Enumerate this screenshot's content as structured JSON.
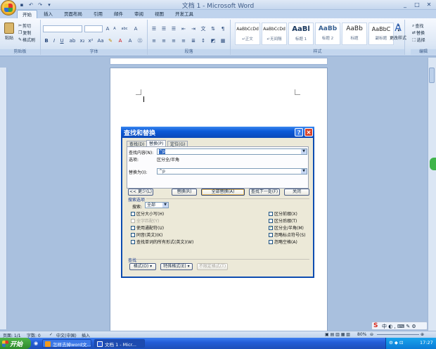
{
  "window": {
    "title": "文档 1 - Microsoft Word",
    "min": "_",
    "max": "□",
    "close": "✕"
  },
  "tabs": [
    "开始",
    "插入",
    "页面布局",
    "引用",
    "邮件",
    "审阅",
    "视图",
    "开发工具"
  ],
  "ribbon": {
    "clipboard": {
      "label": "剪贴板",
      "paste": "粘贴",
      "cut": "剪切",
      "copy": "复制",
      "format_painter": "格式刷"
    },
    "font": {
      "label": "字体",
      "bold": "B",
      "italic": "I",
      "underline": "U",
      "grow": "A",
      "shrink": "A",
      "clear": "abc",
      "char_border": "A"
    },
    "paragraph": {
      "label": "段落"
    },
    "styles": {
      "label": "样式",
      "items": [
        {
          "sample": "AaBbCcDd",
          "name": "↵正文"
        },
        {
          "sample": "AaBbCcDd",
          "name": "↵无间隔"
        },
        {
          "sample": "AaBl",
          "name": "标题 1"
        },
        {
          "sample": "AaBb",
          "name": "标题 2"
        },
        {
          "sample": "AaBb",
          "name": "标题"
        },
        {
          "sample": "AaBbC",
          "name": "副标题"
        }
      ],
      "change_styles": "更改样式"
    },
    "editing": {
      "label": "编辑",
      "find": "查找",
      "replace": "替换",
      "select": "选择"
    }
  },
  "dialog": {
    "title": "查找和替换",
    "help": "?",
    "close": "✕",
    "tabs": [
      "查找(D)",
      "替换(P)",
      "定位(G)"
    ],
    "find_label": "查找内容(N):",
    "find_value": "^p",
    "options_label": "选项:",
    "options_value": "区分全/半角",
    "replace_label": "替换为(I):",
    "replace_value": "^p",
    "buttons": {
      "less": "<< 更少(L)",
      "replace": "替换(R)",
      "replace_all": "全部替换(A)",
      "find_next": "查找下一处(F)",
      "close": "关闭"
    },
    "search_options_title": "搜索选项",
    "search_label": "搜索:",
    "search_value": "全部",
    "left_options": [
      {
        "label": "区分大小写(H)",
        "checked": false,
        "disabled": false
      },
      {
        "label": "全字匹配(Y)",
        "checked": false,
        "disabled": true
      },
      {
        "label": "使用通配符(U)",
        "checked": false,
        "disabled": false
      },
      {
        "label": "同音(英文)(K)",
        "checked": false,
        "disabled": false
      },
      {
        "label": "查找单词的所有形式(英文)(W)",
        "checked": false,
        "disabled": false
      }
    ],
    "right_options": [
      {
        "label": "区分前缀(X)",
        "checked": false,
        "disabled": false
      },
      {
        "label": "区分后缀(T)",
        "checked": false,
        "disabled": false
      },
      {
        "label": "区分全/半角(M)",
        "checked": true,
        "disabled": false
      },
      {
        "label": "忽略标点符号(S)",
        "checked": false,
        "disabled": false
      },
      {
        "label": "忽略空格(A)",
        "checked": false,
        "disabled": false
      }
    ],
    "find_section_title": "查找",
    "bottom_buttons": {
      "format": "格式(O) ▾",
      "special": "特殊格式(E) ▾",
      "no_format": "不限定格式(T)"
    }
  },
  "status": {
    "page": "页面: 1/1",
    "words": "字数: 0",
    "language": "中文(中国)",
    "mode": "插入",
    "zoom": "80%"
  },
  "taskbar": {
    "start": "开始",
    "tasks": [
      "怎样去掉word文...",
      "文档 1 - Micr..."
    ],
    "clock": "17:27"
  },
  "colors": {
    "accent": "#0b5ad8",
    "taskbar": "#245ed8",
    "start": "#3f9a3a"
  }
}
